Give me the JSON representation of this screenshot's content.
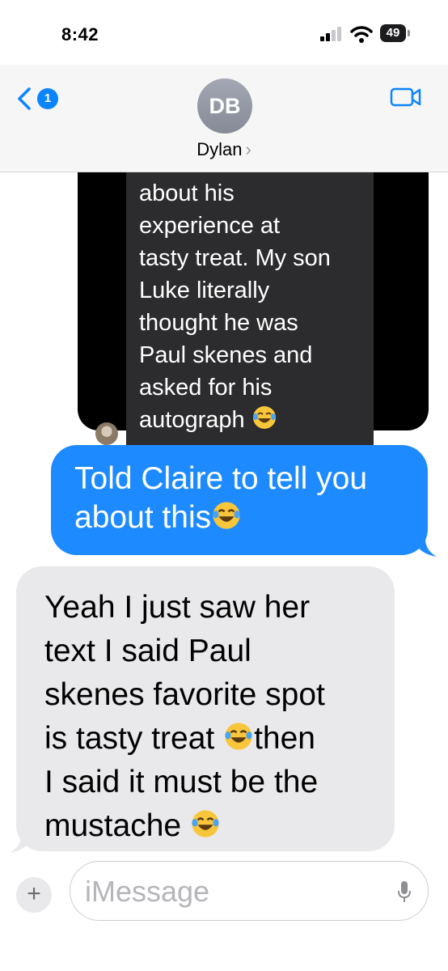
{
  "status_bar": {
    "time": "8:42",
    "battery": "49"
  },
  "header": {
    "back_badge": "1",
    "avatar_initials": "DB",
    "contact_name": "Dylan",
    "chevron": "›"
  },
  "messages": [
    {
      "direction": "received-forwarded",
      "lines": [
        "about his",
        "experience at",
        "tasty treat. My son",
        "Luke literally",
        "thought he was",
        "Paul skenes and",
        "asked for his",
        "autograph"
      ],
      "ends_with_emoji": "crying-laughing"
    },
    {
      "direction": "sent",
      "lines": [
        "Told Claire to tell you",
        "about this"
      ],
      "ends_with_emoji": "crying-laughing"
    },
    {
      "direction": "received",
      "lines": [
        "Yeah I just saw her",
        "text I said Paul",
        "skenes favorite spot",
        "is tasty treat",
        "then",
        "I said it must be the",
        "mustache"
      ],
      "inline_emoji": "crying-laughing"
    }
  ],
  "input": {
    "placeholder": "iMessage",
    "add_label": "+"
  },
  "colors": {
    "sent_bubble": "#1d8bff",
    "received_bubble": "#e9e9eb",
    "accent": "#0a84ff"
  }
}
